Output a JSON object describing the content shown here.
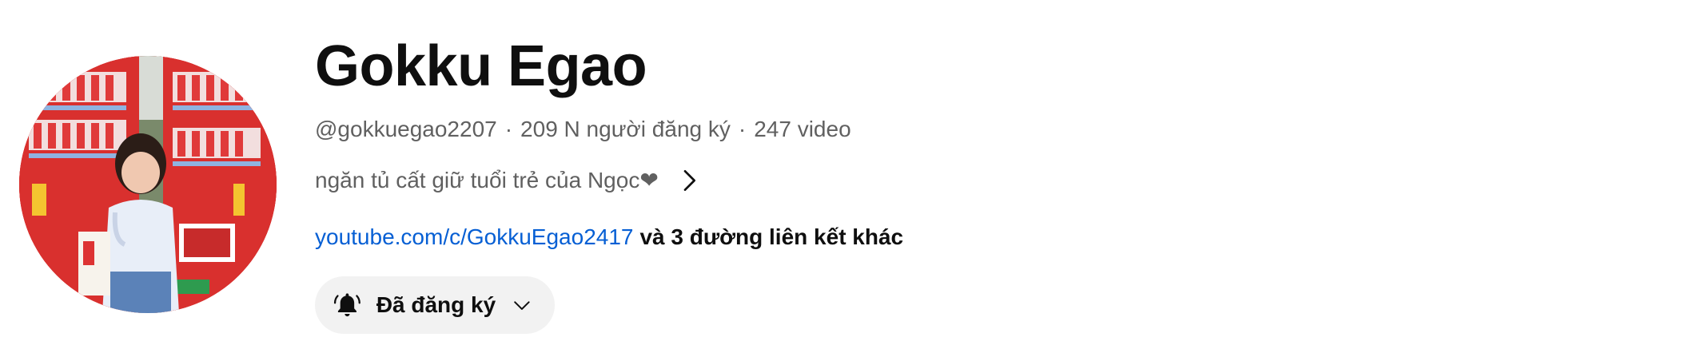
{
  "channel": {
    "name": "Gokku Egao",
    "handle": "@gokkuegao2207",
    "subscribers": "209 N người đăng ký",
    "video_count": "247 video",
    "separator": "·",
    "description": "ngăn tủ cất giữ tuổi trẻ của Ngọc❤"
  },
  "links": {
    "primary_url": "youtube.com/c/GokkuEgao2417",
    "more_links": "và 3 đường liên kết khác"
  },
  "subscribe": {
    "label": "Đã đăng ký"
  },
  "icons": {
    "description_expand": "chevron-right-icon",
    "bell": "bell-icon",
    "dropdown": "chevron-down-icon"
  },
  "colors": {
    "link": "#065fd4",
    "text_primary": "#0f0f0f",
    "text_secondary": "#606060",
    "button_bg": "#f2f2f2"
  }
}
